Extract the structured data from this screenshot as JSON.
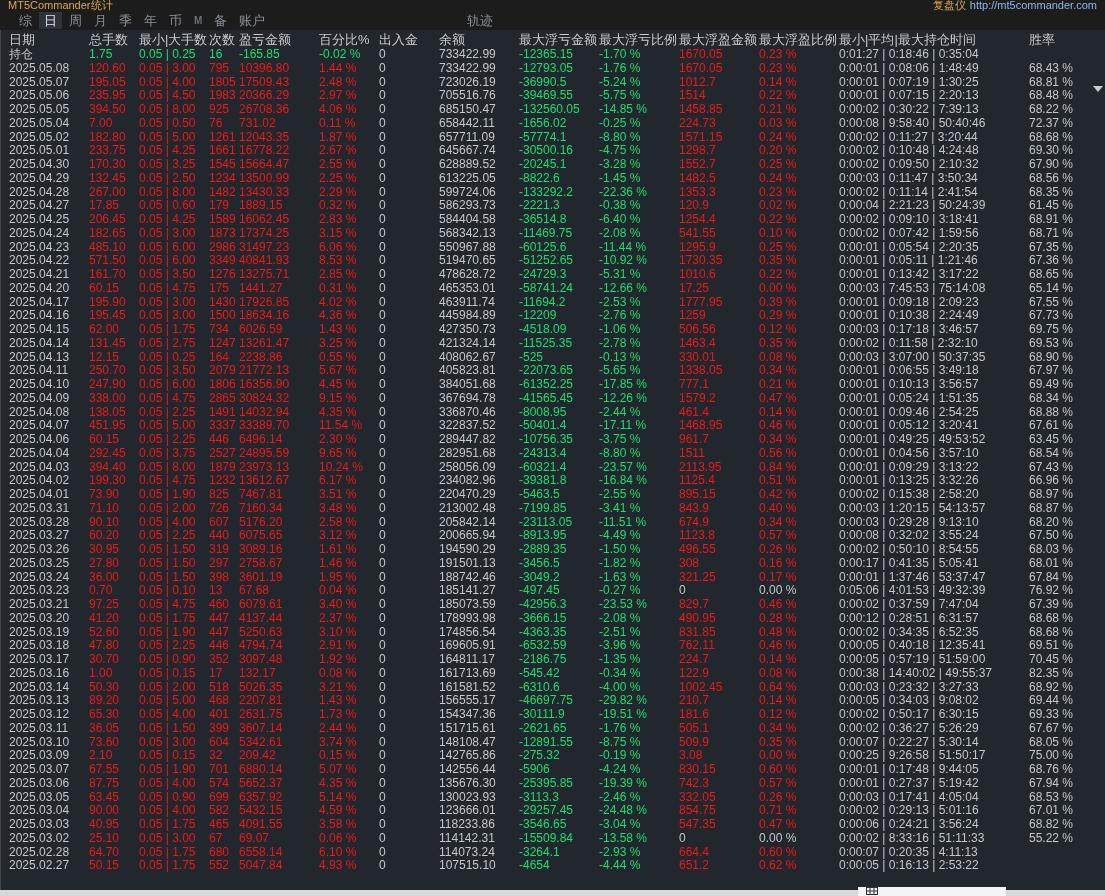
{
  "window": {
    "title": "MT5Commander统计",
    "app_label": "复盘仪",
    "link": "http://mt5commander.com"
  },
  "tabs": [
    {
      "label": "综",
      "selected": false,
      "disabled": false
    },
    {
      "label": "日",
      "selected": true,
      "disabled": false
    },
    {
      "label": "周",
      "selected": false,
      "disabled": false
    },
    {
      "label": "月",
      "selected": false,
      "disabled": false
    },
    {
      "label": "季",
      "selected": false,
      "disabled": false
    },
    {
      "label": "年",
      "selected": false,
      "disabled": false
    },
    {
      "label": "币",
      "selected": false,
      "disabled": false
    },
    {
      "label": "M",
      "selected": false,
      "disabled": true
    },
    {
      "label": "备",
      "selected": false,
      "disabled": false
    },
    {
      "label": "账户",
      "selected": false,
      "disabled": false
    },
    {
      "label": "轨迹",
      "selected": false,
      "disabled": false
    }
  ],
  "table": {
    "columns": [
      "日期",
      "总手数",
      "最小|大手数",
      "次数",
      "盈亏金额",
      "百分比%",
      "出入金",
      "余额",
      "最大浮亏金额",
      "最大浮亏比例",
      "最大浮盈金额",
      "最大浮盈比例",
      "最小|平均|最大持仓时间",
      "胜率"
    ],
    "rows": [
      {
        "kind": "position",
        "flat_profit": false,
        "date": "持仓",
        "lots": "1.75",
        "lot_range": "0.05 | 0.25",
        "trades": "16",
        "pnl": "-165.85",
        "pct": "-0.02 %",
        "deposit": "0",
        "balance": "733422.99",
        "float_loss": "-12365.15",
        "float_loss_pct": "-1.70 %",
        "float_profit": "1670.05",
        "float_profit_pct": "0.23 %",
        "hold_time": "0:01:27 | 0:18:46 | 0:35:04"
      },
      {
        "kind": "day",
        "flat_profit": false,
        "date": "2025.05.08",
        "lots": "120.60",
        "lot_range": "0.05 | 3.00",
        "trades": "795",
        "pnl": "10396.80",
        "pct": "1.44 %",
        "deposit": "0",
        "balance": "733422.99",
        "float_loss": "-12793.05",
        "float_loss_pct": "-1.76 %",
        "float_profit": "1670.05",
        "float_profit_pct": "0.23 %",
        "hold_time": "0:00:01 | 0:08:06 | 1:48:49",
        "win_rate": "68.43 %"
      },
      {
        "kind": "day",
        "flat_profit": false,
        "date": "2025.05.07",
        "lots": "195.05",
        "lot_range": "0.05 | 4.00",
        "trades": "1805",
        "pnl": "17509.43",
        "pct": "2.48 %",
        "deposit": "0",
        "balance": "723026.19",
        "float_loss": "-36990.5",
        "float_loss_pct": "-5.24 %",
        "float_profit": "1012.7",
        "float_profit_pct": "0.14 %",
        "hold_time": "0:00:01 | 0:07:19 | 1:30:25",
        "win_rate": "68.81 %"
      },
      {
        "kind": "day",
        "flat_profit": false,
        "date": "2025.05.06",
        "lots": "235.95",
        "lot_range": "0.05 | 4.50",
        "trades": "1983",
        "pnl": "20366.29",
        "pct": "2.97 %",
        "deposit": "0",
        "balance": "705516.76",
        "float_loss": "-39469.55",
        "float_loss_pct": "-5.75 %",
        "float_profit": "1514",
        "float_profit_pct": "0.22 %",
        "hold_time": "0:00:01 | 0:07:15 | 2:20:13",
        "win_rate": "68.48 %"
      },
      {
        "kind": "day",
        "flat_profit": false,
        "date": "2025.05.05",
        "lots": "394.50",
        "lot_range": "0.05 | 8.00",
        "trades": "925",
        "pnl": "26708.36",
        "pct": "4.06 %",
        "deposit": "0",
        "balance": "685150.47",
        "float_loss": "-132560.05",
        "float_loss_pct": "-14.85 %",
        "float_profit": "1458.85",
        "float_profit_pct": "0.21 %",
        "hold_time": "0:00:02 | 0:30:22 | 7:39:13",
        "win_rate": "68.22 %"
      },
      {
        "kind": "day",
        "flat_profit": false,
        "date": "2025.05.04",
        "lots": "7.00",
        "lot_range": "0.05 | 0.50",
        "trades": "76",
        "pnl": "731.02",
        "pct": "0.11 %",
        "deposit": "0",
        "balance": "658442.11",
        "float_loss": "-1656.02",
        "float_loss_pct": "-0.25 %",
        "float_profit": "224.73",
        "float_profit_pct": "0.03 %",
        "hold_time": "0:00:08 | 9:58:40 | 50:40:46",
        "win_rate": "72.37 %"
      },
      {
        "kind": "day",
        "flat_profit": false,
        "date": "2025.05.02",
        "lots": "182.80",
        "lot_range": "0.05 | 5.00",
        "trades": "1261",
        "pnl": "12043.35",
        "pct": "1.87 %",
        "deposit": "0",
        "balance": "657711.09",
        "float_loss": "-57774.1",
        "float_loss_pct": "-8.80 %",
        "float_profit": "1571.15",
        "float_profit_pct": "0.24 %",
        "hold_time": "0:00:02 | 0:11:27 | 3:20:44",
        "win_rate": "68.68 %"
      },
      {
        "kind": "day",
        "flat_profit": false,
        "date": "2025.05.01",
        "lots": "233.75",
        "lot_range": "0.05 | 4.25",
        "trades": "1661",
        "pnl": "16778.22",
        "pct": "2.67 %",
        "deposit": "0",
        "balance": "645667.74",
        "float_loss": "-30500.16",
        "float_loss_pct": "-4.75 %",
        "float_profit": "1298.7",
        "float_profit_pct": "0.20 %",
        "hold_time": "0:00:02 | 0:10:48 | 4:24:48",
        "win_rate": "69.30 %"
      },
      {
        "kind": "day",
        "flat_profit": false,
        "date": "2025.04.30",
        "lots": "170.30",
        "lot_range": "0.05 | 3.25",
        "trades": "1545",
        "pnl": "15664.47",
        "pct": "2.55 %",
        "deposit": "0",
        "balance": "628889.52",
        "float_loss": "-20245.1",
        "float_loss_pct": "-3.28 %",
        "float_profit": "1552.7",
        "float_profit_pct": "0.25 %",
        "hold_time": "0:00:02 | 0:09:50 | 2:10:32",
        "win_rate": "67.90 %"
      },
      {
        "kind": "day",
        "flat_profit": false,
        "date": "2025.04.29",
        "lots": "132.45",
        "lot_range": "0.05 | 2.50",
        "trades": "1234",
        "pnl": "13500.99",
        "pct": "2.25 %",
        "deposit": "0",
        "balance": "613225.05",
        "float_loss": "-8822.6",
        "float_loss_pct": "-1.45 %",
        "float_profit": "1482.5",
        "float_profit_pct": "0.24 %",
        "hold_time": "0:00:03 | 0:11:47 | 3:50:34",
        "win_rate": "68.56 %"
      },
      {
        "kind": "day",
        "flat_profit": false,
        "date": "2025.04.28",
        "lots": "267.00",
        "lot_range": "0.05 | 8.00",
        "trades": "1482",
        "pnl": "13430.33",
        "pct": "2.29 %",
        "deposit": "0",
        "balance": "599724.06",
        "float_loss": "-133292.2",
        "float_loss_pct": "-22.36 %",
        "float_profit": "1353.3",
        "float_profit_pct": "0.23 %",
        "hold_time": "0:00:02 | 0:11:14 | 2:41:54",
        "win_rate": "68.35 %"
      },
      {
        "kind": "day",
        "flat_profit": false,
        "date": "2025.04.27",
        "lots": "17.85",
        "lot_range": "0.05 | 0.60",
        "trades": "179",
        "pnl": "1889.15",
        "pct": "0.32 %",
        "deposit": "0",
        "balance": "586293.73",
        "float_loss": "-2221.3",
        "float_loss_pct": "-0.38 %",
        "float_profit": "120.9",
        "float_profit_pct": "0.02 %",
        "hold_time": "0:00:04 | 2:21:23 | 50:24:39",
        "win_rate": "61.45 %"
      },
      {
        "kind": "day",
        "flat_profit": false,
        "date": "2025.04.25",
        "lots": "206.45",
        "lot_range": "0.05 | 4.25",
        "trades": "1589",
        "pnl": "16062.45",
        "pct": "2.83 %",
        "deposit": "0",
        "balance": "584404.58",
        "float_loss": "-36514.8",
        "float_loss_pct": "-6.40 %",
        "float_profit": "1254.4",
        "float_profit_pct": "0.22 %",
        "hold_time": "0:00:02 | 0:09:10 | 3:18:41",
        "win_rate": "68.91 %"
      },
      {
        "kind": "day",
        "flat_profit": false,
        "date": "2025.04.24",
        "lots": "182.65",
        "lot_range": "0.05 | 3.00",
        "trades": "1873",
        "pnl": "17374.25",
        "pct": "3.15 %",
        "deposit": "0",
        "balance": "568342.13",
        "float_loss": "-11469.75",
        "float_loss_pct": "-2.08 %",
        "float_profit": "541.55",
        "float_profit_pct": "0.10 %",
        "hold_time": "0:00:02 | 0:07:42 | 1:59:56",
        "win_rate": "68.71 %"
      },
      {
        "kind": "day",
        "flat_profit": false,
        "date": "2025.04.23",
        "lots": "485.10",
        "lot_range": "0.05 | 6.00",
        "trades": "2986",
        "pnl": "31497.23",
        "pct": "6.06 %",
        "deposit": "0",
        "balance": "550967.88",
        "float_loss": "-60125.6",
        "float_loss_pct": "-11.44 %",
        "float_profit": "1295.9",
        "float_profit_pct": "0.25 %",
        "hold_time": "0:00:01 | 0:05:54 | 2:20:35",
        "win_rate": "67.35 %"
      },
      {
        "kind": "day",
        "flat_profit": false,
        "date": "2025.04.22",
        "lots": "571.50",
        "lot_range": "0.05 | 6.00",
        "trades": "3349",
        "pnl": "40841.93",
        "pct": "8.53 %",
        "deposit": "0",
        "balance": "519470.65",
        "float_loss": "-51252.65",
        "float_loss_pct": "-10.92 %",
        "float_profit": "1730.35",
        "float_profit_pct": "0.35 %",
        "hold_time": "0:00:01 | 0:05:11 | 1:21:46",
        "win_rate": "67.36 %"
      },
      {
        "kind": "day",
        "flat_profit": false,
        "date": "2025.04.21",
        "lots": "161.70",
        "lot_range": "0.05 | 3.50",
        "trades": "1276",
        "pnl": "13275.71",
        "pct": "2.85 %",
        "deposit": "0",
        "balance": "478628.72",
        "float_loss": "-24729.3",
        "float_loss_pct": "-5.31 %",
        "float_profit": "1010.6",
        "float_profit_pct": "0.22 %",
        "hold_time": "0:00:01 | 0:13:42 | 3:17:22",
        "win_rate": "68.65 %"
      },
      {
        "kind": "day",
        "flat_profit": false,
        "date": "2025.04.20",
        "lots": "60.15",
        "lot_range": "0.05 | 4.75",
        "trades": "175",
        "pnl": "1441.27",
        "pct": "0.31 %",
        "deposit": "0",
        "balance": "465353.01",
        "float_loss": "-58741.24",
        "float_loss_pct": "-12.66 %",
        "float_profit": "17.25",
        "float_profit_pct": "0.00 %",
        "hold_time": "0:00:03 | 7:45:53 | 75:14:08",
        "win_rate": "65.14 %"
      },
      {
        "kind": "day",
        "flat_profit": false,
        "date": "2025.04.17",
        "lots": "195.90",
        "lot_range": "0.05 | 3.00",
        "trades": "1430",
        "pnl": "17926.85",
        "pct": "4.02 %",
        "deposit": "0",
        "balance": "463911.74",
        "float_loss": "-11694.2",
        "float_loss_pct": "-2.53 %",
        "float_profit": "1777.95",
        "float_profit_pct": "0.39 %",
        "hold_time": "0:00:01 | 0:09:18 | 2:09:23",
        "win_rate": "67.55 %"
      },
      {
        "kind": "day",
        "flat_profit": false,
        "date": "2025.04.16",
        "lots": "195.45",
        "lot_range": "0.05 | 3.00",
        "trades": "1500",
        "pnl": "18634.16",
        "pct": "4.36 %",
        "deposit": "0",
        "balance": "445984.89",
        "float_loss": "-12209",
        "float_loss_pct": "-2.76 %",
        "float_profit": "1259",
        "float_profit_pct": "0.29 %",
        "hold_time": "0:00:01 | 0:10:38 | 2:24:49",
        "win_rate": "67.73 %"
      },
      {
        "kind": "day",
        "flat_profit": false,
        "date": "2025.04.15",
        "lots": "62.00",
        "lot_range": "0.05 | 1.75",
        "trades": "734",
        "pnl": "6026.59",
        "pct": "1.43 %",
        "deposit": "0",
        "balance": "427350.73",
        "float_loss": "-4518.09",
        "float_loss_pct": "-1.06 %",
        "float_profit": "506.56",
        "float_profit_pct": "0.12 %",
        "hold_time": "0:00:03 | 0:17:18 | 3:46:57",
        "win_rate": "69.75 %"
      },
      {
        "kind": "day",
        "flat_profit": false,
        "date": "2025.04.14",
        "lots": "131.45",
        "lot_range": "0.05 | 2.75",
        "trades": "1247",
        "pnl": "13261.47",
        "pct": "3.25 %",
        "deposit": "0",
        "balance": "421324.14",
        "float_loss": "-11525.35",
        "float_loss_pct": "-2.78 %",
        "float_profit": "1463.4",
        "float_profit_pct": "0.35 %",
        "hold_time": "0:00:02 | 0:11:58 | 2:32:10",
        "win_rate": "69.53 %"
      },
      {
        "kind": "day",
        "flat_profit": false,
        "date": "2025.04.13",
        "lots": "12.15",
        "lot_range": "0.05 | 0.25",
        "trades": "164",
        "pnl": "2238.86",
        "pct": "0.55 %",
        "deposit": "0",
        "balance": "408062.67",
        "float_loss": "-525",
        "float_loss_pct": "-0.13 %",
        "float_profit": "330.01",
        "float_profit_pct": "0.08 %",
        "hold_time": "0:00:03 | 3:07:00 | 50:37:35",
        "win_rate": "68.90 %"
      },
      {
        "kind": "day",
        "flat_profit": false,
        "date": "2025.04.11",
        "lots": "250.70",
        "lot_range": "0.05 | 3.50",
        "trades": "2079",
        "pnl": "21772.13",
        "pct": "5.67 %",
        "deposit": "0",
        "balance": "405823.81",
        "float_loss": "-22073.65",
        "float_loss_pct": "-5.65 %",
        "float_profit": "1338.05",
        "float_profit_pct": "0.34 %",
        "hold_time": "0:00:01 | 0:06:55 | 3:49:18",
        "win_rate": "67.97 %"
      },
      {
        "kind": "day",
        "flat_profit": false,
        "date": "2025.04.10",
        "lots": "247.90",
        "lot_range": "0.05 | 6.00",
        "trades": "1806",
        "pnl": "16356.90",
        "pct": "4.45 %",
        "deposit": "0",
        "balance": "384051.68",
        "float_loss": "-61352.25",
        "float_loss_pct": "-17.85 %",
        "float_profit": "777.1",
        "float_profit_pct": "0.21 %",
        "hold_time": "0:00:01 | 0:10:13 | 3:56:57",
        "win_rate": "69.49 %"
      },
      {
        "kind": "day",
        "flat_profit": false,
        "date": "2025.04.09",
        "lots": "338.00",
        "lot_range": "0.05 | 4.75",
        "trades": "2865",
        "pnl": "30824.32",
        "pct": "9.15 %",
        "deposit": "0",
        "balance": "367694.78",
        "float_loss": "-41565.45",
        "float_loss_pct": "-12.26 %",
        "float_profit": "1579.2",
        "float_profit_pct": "0.47 %",
        "hold_time": "0:00:01 | 0:05:24 | 1:51:35",
        "win_rate": "68.34 %"
      },
      {
        "kind": "day",
        "flat_profit": false,
        "date": "2025.04.08",
        "lots": "138.05",
        "lot_range": "0.05 | 2.25",
        "trades": "1491",
        "pnl": "14032.94",
        "pct": "4.35 %",
        "deposit": "0",
        "balance": "336870.46",
        "float_loss": "-8008.95",
        "float_loss_pct": "-2.44 %",
        "float_profit": "461.4",
        "float_profit_pct": "0.14 %",
        "hold_time": "0:00:01 | 0:09:46 | 2:54:25",
        "win_rate": "68.88 %"
      },
      {
        "kind": "day",
        "flat_profit": false,
        "date": "2025.04.07",
        "lots": "451.95",
        "lot_range": "0.05 | 5.00",
        "trades": "3337",
        "pnl": "33389.70",
        "pct": "11.54 %",
        "deposit": "0",
        "balance": "322837.52",
        "float_loss": "-50401.4",
        "float_loss_pct": "-17.11 %",
        "float_profit": "1468.95",
        "float_profit_pct": "0.46 %",
        "hold_time": "0:00:01 | 0:05:12 | 3:20:41",
        "win_rate": "67.61 %"
      },
      {
        "kind": "day",
        "flat_profit": false,
        "date": "2025.04.06",
        "lots": "60.15",
        "lot_range": "0.05 | 2.25",
        "trades": "446",
        "pnl": "6496.14",
        "pct": "2.30 %",
        "deposit": "0",
        "balance": "289447.82",
        "float_loss": "-10756.35",
        "float_loss_pct": "-3.75 %",
        "float_profit": "961.7",
        "float_profit_pct": "0.34 %",
        "hold_time": "0:00:01 | 0:49:25 | 49:53:52",
        "win_rate": "63.45 %"
      },
      {
        "kind": "day",
        "flat_profit": false,
        "date": "2025.04.04",
        "lots": "292.45",
        "lot_range": "0.05 | 3.75",
        "trades": "2527",
        "pnl": "24895.59",
        "pct": "9.65 %",
        "deposit": "0",
        "balance": "282951.68",
        "float_loss": "-24313.4",
        "float_loss_pct": "-8.80 %",
        "float_profit": "1511",
        "float_profit_pct": "0.56 %",
        "hold_time": "0:00:01 | 0:04:56 | 3:57:10",
        "win_rate": "68.54 %"
      },
      {
        "kind": "day",
        "flat_profit": false,
        "date": "2025.04.03",
        "lots": "394.40",
        "lot_range": "0.05 | 8.00",
        "trades": "1879",
        "pnl": "23973.13",
        "pct": "10.24 %",
        "deposit": "0",
        "balance": "258056.09",
        "float_loss": "-60321.4",
        "float_loss_pct": "-23.57 %",
        "float_profit": "2113.95",
        "float_profit_pct": "0.84 %",
        "hold_time": "0:00:01 | 0:09:29 | 3:13:22",
        "win_rate": "67.43 %"
      },
      {
        "kind": "day",
        "flat_profit": false,
        "date": "2025.04.02",
        "lots": "199.30",
        "lot_range": "0.05 | 4.75",
        "trades": "1232",
        "pnl": "13612.67",
        "pct": "6.17 %",
        "deposit": "0",
        "balance": "234082.96",
        "float_loss": "-39381.8",
        "float_loss_pct": "-16.84 %",
        "float_profit": "1125.4",
        "float_profit_pct": "0.51 %",
        "hold_time": "0:00:01 | 0:13:25 | 3:32:26",
        "win_rate": "66.96 %"
      },
      {
        "kind": "day",
        "flat_profit": false,
        "date": "2025.04.01",
        "lots": "73.90",
        "lot_range": "0.05 | 1.90",
        "trades": "825",
        "pnl": "7467.81",
        "pct": "3.51 %",
        "deposit": "0",
        "balance": "220470.29",
        "float_loss": "-5463.5",
        "float_loss_pct": "-2.55 %",
        "float_profit": "895.15",
        "float_profit_pct": "0.42 %",
        "hold_time": "0:00:02 | 0:15:38 | 2:58:20",
        "win_rate": "68.97 %"
      },
      {
        "kind": "day",
        "flat_profit": false,
        "date": "2025.03.31",
        "lots": "71.10",
        "lot_range": "0.05 | 2.00",
        "trades": "726",
        "pnl": "7160.34",
        "pct": "3.48 %",
        "deposit": "0",
        "balance": "213002.48",
        "float_loss": "-7199.85",
        "float_loss_pct": "-3.41 %",
        "float_profit": "843.9",
        "float_profit_pct": "0.40 %",
        "hold_time": "0:00:03 | 1:20:15 | 54:13:57",
        "win_rate": "68.87 %"
      },
      {
        "kind": "day",
        "flat_profit": false,
        "date": "2025.03.28",
        "lots": "90.10",
        "lot_range": "0.05 | 4.00",
        "trades": "607",
        "pnl": "5176.20",
        "pct": "2.58 %",
        "deposit": "0",
        "balance": "205842.14",
        "float_loss": "-23113.05",
        "float_loss_pct": "-11.51 %",
        "float_profit": "674.9",
        "float_profit_pct": "0.34 %",
        "hold_time": "0:00:03 | 0:29:28 | 9:13:10",
        "win_rate": "68.20 %"
      },
      {
        "kind": "day",
        "flat_profit": false,
        "date": "2025.03.27",
        "lots": "60.20",
        "lot_range": "0.05 | 2.25",
        "trades": "440",
        "pnl": "6075.65",
        "pct": "3.12 %",
        "deposit": "0",
        "balance": "200665.94",
        "float_loss": "-8913.95",
        "float_loss_pct": "-4.49 %",
        "float_profit": "1123.8",
        "float_profit_pct": "0.57 %",
        "hold_time": "0:00:08 | 0:32:02 | 3:55:24",
        "win_rate": "67.50 %"
      },
      {
        "kind": "day",
        "flat_profit": false,
        "date": "2025.03.26",
        "lots": "30.95",
        "lot_range": "0.05 | 1.50",
        "trades": "319",
        "pnl": "3089.16",
        "pct": "1.61 %",
        "deposit": "0",
        "balance": "194590.29",
        "float_loss": "-2889.35",
        "float_loss_pct": "-1.50 %",
        "float_profit": "496.55",
        "float_profit_pct": "0.26 %",
        "hold_time": "0:00:02 | 0:50:10 | 8:54:55",
        "win_rate": "68.03 %"
      },
      {
        "kind": "day",
        "flat_profit": false,
        "date": "2025.03.25",
        "lots": "27.80",
        "lot_range": "0.05 | 1.50",
        "trades": "297",
        "pnl": "2758.67",
        "pct": "1.46 %",
        "deposit": "0",
        "balance": "191501.13",
        "float_loss": "-3456.5",
        "float_loss_pct": "-1.82 %",
        "float_profit": "308",
        "float_profit_pct": "0.16 %",
        "hold_time": "0:00:17 | 0:41:35 | 5:05:41",
        "win_rate": "68.01 %"
      },
      {
        "kind": "day",
        "flat_profit": false,
        "date": "2025.03.24",
        "lots": "36.00",
        "lot_range": "0.05 | 1.50",
        "trades": "398",
        "pnl": "3601.19",
        "pct": "1.95 %",
        "deposit": "0",
        "balance": "188742.46",
        "float_loss": "-3049.2",
        "float_loss_pct": "-1.63 %",
        "float_profit": "321.25",
        "float_profit_pct": "0.17 %",
        "hold_time": "0:00:01 | 1:37:46 | 53:37:47",
        "win_rate": "67.84 %"
      },
      {
        "kind": "day",
        "flat_profit": true,
        "date": "2025.03.23",
        "lots": "0.70",
        "lot_range": "0.05 | 0.10",
        "trades": "13",
        "pnl": "67.68",
        "pct": "0.04 %",
        "deposit": "0",
        "balance": "185141.27",
        "float_loss": "-497.45",
        "float_loss_pct": "-0.27 %",
        "float_profit": "0",
        "float_profit_pct": "0.00 %",
        "hold_time": "0:05:06 | 4:01:53 | 49:32:39",
        "win_rate": "76.92 %"
      },
      {
        "kind": "day",
        "flat_profit": false,
        "date": "2025.03.21",
        "lots": "97.25",
        "lot_range": "0.05 | 4.75",
        "trades": "460",
        "pnl": "6079.61",
        "pct": "3.40 %",
        "deposit": "0",
        "balance": "185073.59",
        "float_loss": "-42956.3",
        "float_loss_pct": "-23.53 %",
        "float_profit": "829.7",
        "float_profit_pct": "0.46 %",
        "hold_time": "0:00:02 | 0:37:59 | 7:47:04",
        "win_rate": "67.39 %"
      },
      {
        "kind": "day",
        "flat_profit": false,
        "date": "2025.03.20",
        "lots": "41.20",
        "lot_range": "0.05 | 1.75",
        "trades": "447",
        "pnl": "4137.44",
        "pct": "2.37 %",
        "deposit": "0",
        "balance": "178993.98",
        "float_loss": "-3666.15",
        "float_loss_pct": "-2.08 %",
        "float_profit": "490.95",
        "float_profit_pct": "0.28 %",
        "hold_time": "0:00:12 | 0:28:51 | 6:31:57",
        "win_rate": "68.68 %"
      },
      {
        "kind": "day",
        "flat_profit": false,
        "date": "2025.03.19",
        "lots": "52.60",
        "lot_range": "0.05 | 1.90",
        "trades": "447",
        "pnl": "5250.63",
        "pct": "3.10 %",
        "deposit": "0",
        "balance": "174856.54",
        "float_loss": "-4363.35",
        "float_loss_pct": "-2.51 %",
        "float_profit": "831.85",
        "float_profit_pct": "0.48 %",
        "hold_time": "0:00:02 | 0:34:35 | 6:52:35",
        "win_rate": "68.68 %"
      },
      {
        "kind": "day",
        "flat_profit": false,
        "date": "2025.03.18",
        "lots": "47.80",
        "lot_range": "0.05 | 2.25",
        "trades": "446",
        "pnl": "4794.74",
        "pct": "2.91 %",
        "deposit": "0",
        "balance": "169605.91",
        "float_loss": "-6532.59",
        "float_loss_pct": "-3.96 %",
        "float_profit": "762.11",
        "float_profit_pct": "0.46 %",
        "hold_time": "0:00:05 | 0:40:18 | 12:35:41",
        "win_rate": "69.51 %"
      },
      {
        "kind": "day",
        "flat_profit": false,
        "date": "2025.03.17",
        "lots": "30.70",
        "lot_range": "0.05 | 0.90",
        "trades": "352",
        "pnl": "3097.48",
        "pct": "1.92 %",
        "deposit": "0",
        "balance": "164811.17",
        "float_loss": "-2186.75",
        "float_loss_pct": "-1.35 %",
        "float_profit": "224.7",
        "float_profit_pct": "0.14 %",
        "hold_time": "0:00:05 | 0:57:19 | 51:59:00",
        "win_rate": "70.45 %"
      },
      {
        "kind": "day",
        "flat_profit": false,
        "date": "2025.03.16",
        "lots": "1.00",
        "lot_range": "0.05 | 0.15",
        "trades": "17",
        "pnl": "132.17",
        "pct": "0.08 %",
        "deposit": "0",
        "balance": "161713.69",
        "float_loss": "-545.42",
        "float_loss_pct": "-0.34 %",
        "float_profit": "122.9",
        "float_profit_pct": "0.08 %",
        "hold_time": "0:00:38 | 14:40:02 | 49:55:37",
        "win_rate": "82.35 %"
      },
      {
        "kind": "day",
        "flat_profit": false,
        "date": "2025.03.14",
        "lots": "50.30",
        "lot_range": "0.05 | 2.00",
        "trades": "518",
        "pnl": "5026.35",
        "pct": "3.21 %",
        "deposit": "0",
        "balance": "161581.52",
        "float_loss": "-6310.6",
        "float_loss_pct": "-4.00 %",
        "float_profit": "1002.45",
        "float_profit_pct": "0.64 %",
        "hold_time": "0:00:03 | 0:23:32 | 3:27:33",
        "win_rate": "68.92 %"
      },
      {
        "kind": "day",
        "flat_profit": false,
        "date": "2025.03.13",
        "lots": "89.20",
        "lot_range": "0.05 | 5.00",
        "trades": "468",
        "pnl": "2207.81",
        "pct": "1.43 %",
        "deposit": "0",
        "balance": "156555.17",
        "float_loss": "-46697.75",
        "float_loss_pct": "-29.82 %",
        "float_profit": "210.7",
        "float_profit_pct": "0.14 %",
        "hold_time": "0:00:05 | 0:34:03 | 9:08:02",
        "win_rate": "69.44 %"
      },
      {
        "kind": "day",
        "flat_profit": false,
        "date": "2025.03.12",
        "lots": "65.30",
        "lot_range": "0.05 | 4.00",
        "trades": "401",
        "pnl": "2631.75",
        "pct": "1.73 %",
        "deposit": "0",
        "balance": "154347.36",
        "float_loss": "-30111.9",
        "float_loss_pct": "-19.51 %",
        "float_profit": "181.6",
        "float_profit_pct": "0.12 %",
        "hold_time": "0:00:02 | 0:50:17 | 6:30:15",
        "win_rate": "69.33 %"
      },
      {
        "kind": "day",
        "flat_profit": false,
        "date": "2025.03.11",
        "lots": "36.05",
        "lot_range": "0.05 | 1.50",
        "trades": "399",
        "pnl": "3607.14",
        "pct": "2.44 %",
        "deposit": "0",
        "balance": "151715.61",
        "float_loss": "-2621.65",
        "float_loss_pct": "-1.76 %",
        "float_profit": "505.1",
        "float_profit_pct": "0.34 %",
        "hold_time": "0:00:02 | 0:36:27 | 5:26:29",
        "win_rate": "67.67 %"
      },
      {
        "kind": "day",
        "flat_profit": false,
        "date": "2025.03.10",
        "lots": "73.60",
        "lot_range": "0.05 | 3.00",
        "trades": "604",
        "pnl": "5342.61",
        "pct": "3.74 %",
        "deposit": "0",
        "balance": "148108.47",
        "float_loss": "-12891.55",
        "float_loss_pct": "-8.75 %",
        "float_profit": "509.9",
        "float_profit_pct": "0.35 %",
        "hold_time": "0:00:07 | 0:22:27 | 5:30:14",
        "win_rate": "68.05 %"
      },
      {
        "kind": "day",
        "flat_profit": false,
        "date": "2025.03.09",
        "lots": "2.10",
        "lot_range": "0.05 | 0.15",
        "trades": "32",
        "pnl": "209.42",
        "pct": "0.15 %",
        "deposit": "0",
        "balance": "142765.86",
        "float_loss": "-275.32",
        "float_loss_pct": "-0.19 %",
        "float_profit": "3.08",
        "float_profit_pct": "0.00 %",
        "hold_time": "0:00:25 | 9:26:58 | 51:50:17",
        "win_rate": "75.00 %"
      },
      {
        "kind": "day",
        "flat_profit": false,
        "date": "2025.03.07",
        "lots": "67.55",
        "lot_range": "0.05 | 1.90",
        "trades": "701",
        "pnl": "6880.14",
        "pct": "5.07 %",
        "deposit": "0",
        "balance": "142556.44",
        "float_loss": "-5906",
        "float_loss_pct": "-4.24 %",
        "float_profit": "830.15",
        "float_profit_pct": "0.60 %",
        "hold_time": "0:00:01 | 0:17:48 | 9:44:05",
        "win_rate": "68.76 %"
      },
      {
        "kind": "day",
        "flat_profit": false,
        "date": "2025.03.06",
        "lots": "87.75",
        "lot_range": "0.05 | 4.00",
        "trades": "574",
        "pnl": "5652.37",
        "pct": "4.35 %",
        "deposit": "0",
        "balance": "135676.30",
        "float_loss": "-25395.85",
        "float_loss_pct": "-19.39 %",
        "float_profit": "742.3",
        "float_profit_pct": "0.57 %",
        "hold_time": "0:00:01 | 0:27:37 | 5:19:42",
        "win_rate": "67.94 %"
      },
      {
        "kind": "day",
        "flat_profit": false,
        "date": "2025.03.05",
        "lots": "63.45",
        "lot_range": "0.05 | 0.90",
        "trades": "699",
        "pnl": "6357.92",
        "pct": "5.14 %",
        "deposit": "0",
        "balance": "130023.93",
        "float_loss": "-3113.3",
        "float_loss_pct": "-2.46 %",
        "float_profit": "332.05",
        "float_profit_pct": "0.26 %",
        "hold_time": "0:00:03 | 0:17:41 | 4:05:04",
        "win_rate": "68.53 %"
      },
      {
        "kind": "day",
        "flat_profit": false,
        "date": "2025.03.04",
        "lots": "90.00",
        "lot_range": "0.05 | 4.00",
        "trades": "582",
        "pnl": "5432.15",
        "pct": "4.59 %",
        "deposit": "0",
        "balance": "123666.01",
        "float_loss": "-29257.45",
        "float_loss_pct": "-24.48 %",
        "float_profit": "854.75",
        "float_profit_pct": "0.71 %",
        "hold_time": "0:00:02 | 0:29:13 | 5:01:16",
        "win_rate": "67.01 %"
      },
      {
        "kind": "day",
        "flat_profit": false,
        "date": "2025.03.03",
        "lots": "40.95",
        "lot_range": "0.05 | 1.75",
        "trades": "465",
        "pnl": "4091.55",
        "pct": "3.58 %",
        "deposit": "0",
        "balance": "118233.86",
        "float_loss": "-3546.65",
        "float_loss_pct": "-3.04 %",
        "float_profit": "547.35",
        "float_profit_pct": "0.47 %",
        "hold_time": "0:00:06 | 0:24:21 | 3:56:24",
        "win_rate": "68.82 %"
      },
      {
        "kind": "day",
        "flat_profit": true,
        "date": "2025.03.02",
        "lots": "25.10",
        "lot_range": "0.05 | 3.00",
        "trades": "67",
        "pnl": "69.07",
        "pct": "0.06 %",
        "deposit": "0",
        "balance": "114142.31",
        "float_loss": "-15509.84",
        "float_loss_pct": "-13.58 %",
        "float_profit": "0",
        "float_profit_pct": "0.00 %",
        "hold_time": "0:00:02 | 8:33:16 | 51:11:33",
        "win_rate": "55.22 %"
      },
      {
        "kind": "day",
        "flat_profit": false,
        "date": "2025.02.28",
        "lots": "64.70",
        "lot_range": "0.05 | 1.75",
        "trades": "680",
        "pnl": "6558.14",
        "pct": "6.10 %",
        "deposit": "0",
        "balance": "114073.24",
        "float_loss": "-3264.1",
        "float_loss_pct": "-2.93 %",
        "float_profit": "664.4",
        "float_profit_pct": "0.60 %",
        "hold_time": "0:00:07 | 0:20:35 | 4:11:13"
      },
      {
        "kind": "day",
        "flat_profit": false,
        "date": "2025.02.27",
        "lots": "50.15",
        "lot_range": "0.05 | 1.75",
        "trades": "552",
        "pnl": "5047.84",
        "pct": "4.93 %",
        "deposit": "0",
        "balance": "107515.10",
        "float_loss": "-4654",
        "float_loss_pct": "-4.44 %",
        "float_profit": "651.2",
        "float_profit_pct": "0.62 %",
        "hold_time": "0:00:05 | 0:16:13 | 2:53:22"
      }
    ]
  }
}
